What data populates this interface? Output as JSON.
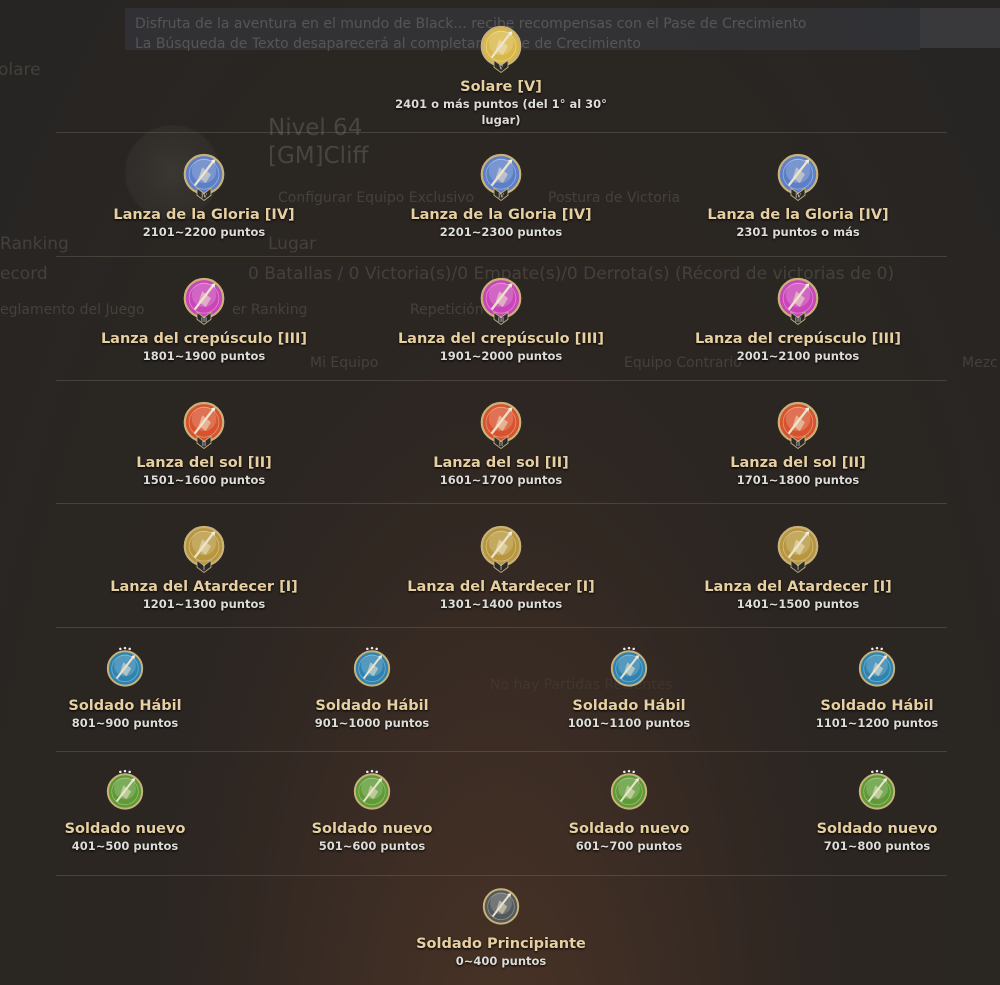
{
  "background": {
    "banner_line1": "Disfruta de la aventura en el mundo de Black... recibe recompensas con el Pase de Crecimiento",
    "banner_line2": "La Búsqueda de Texto desaparecerá al completar... Pase de Crecimiento",
    "side_label": "olare",
    "level": "Nivel 64",
    "player_name": "[GM]Cliff",
    "config_left": "Configurar Equipo Exclusivo",
    "config_right": "Postura de Victoria",
    "lugar": "Lugar",
    "ranking": "Ranking",
    "record": "ecord",
    "record_text": "0 Batallas / 0 Victoria(s)/0 Empate(s)/0 Derrota(s) (Récord de victorias de 0)",
    "reglamento": "eglamento del Juego",
    "ver_ranking": "er Ranking",
    "repeticion": "Repetición",
    "mi_equipo": "Mi Equipo",
    "equipo_contrario": "Equipo Contrario",
    "right_cut": "Mezc",
    "mid_faded": "No hay Partidas Recientes"
  },
  "tiers": [
    {
      "id": "solare",
      "name": "Solare [V]",
      "points": "2401 o más puntos (del 1° al 30° lugar)",
      "tier": "V",
      "color": "#d9b84a"
    },
    {
      "id": "gloria-1",
      "name": "Lanza de la Gloria [IV]",
      "points": "2101~2200 puntos",
      "tier": "IV",
      "color": "#5d7fc6"
    },
    {
      "id": "gloria-2",
      "name": "Lanza de la Gloria [IV]",
      "points": "2201~2300 puntos",
      "tier": "IV",
      "color": "#5d7fc6"
    },
    {
      "id": "gloria-3",
      "name": "Lanza de la Gloria [IV]",
      "points": "2301 puntos o más",
      "tier": "IV",
      "color": "#5d7fc6"
    },
    {
      "id": "crepusculo-1",
      "name": "Lanza del crepúsculo [III]",
      "points": "1801~1900 puntos",
      "tier": "III",
      "color": "#c945b8"
    },
    {
      "id": "crepusculo-2",
      "name": "Lanza del crepúsculo [III]",
      "points": "1901~2000 puntos",
      "tier": "III",
      "color": "#c945b8"
    },
    {
      "id": "crepusculo-3",
      "name": "Lanza del crepúsculo [III]",
      "points": "2001~2100 puntos",
      "tier": "III",
      "color": "#c945b8"
    },
    {
      "id": "sol-1",
      "name": "Lanza del sol [II]",
      "points": "1501~1600 puntos",
      "tier": "II",
      "color": "#d8532d"
    },
    {
      "id": "sol-2",
      "name": "Lanza del sol [II]",
      "points": "1601~1700 puntos",
      "tier": "II",
      "color": "#d8532d"
    },
    {
      "id": "sol-3",
      "name": "Lanza del sol [II]",
      "points": "1701~1800 puntos",
      "tier": "II",
      "color": "#d8532d"
    },
    {
      "id": "atardecer-1",
      "name": "Lanza del Atardecer [I]",
      "points": "1201~1300 puntos",
      "tier": "I",
      "color": "#b8963e"
    },
    {
      "id": "atardecer-2",
      "name": "Lanza del Atardecer [I]",
      "points": "1301~1400 puntos",
      "tier": "I",
      "color": "#b8963e"
    },
    {
      "id": "atardecer-3",
      "name": "Lanza del Atardecer [I]",
      "points": "1401~1500 puntos",
      "tier": "I",
      "color": "#b8963e"
    },
    {
      "id": "habil-1",
      "name": "Soldado Hábil",
      "points": "801~900 puntos",
      "tier": "",
      "color": "#2f83b0"
    },
    {
      "id": "habil-2",
      "name": "Soldado Hábil",
      "points": "901~1000 puntos",
      "tier": "",
      "color": "#2f83b0"
    },
    {
      "id": "habil-3",
      "name": "Soldado Hábil",
      "points": "1001~1100 puntos",
      "tier": "",
      "color": "#2f83b0"
    },
    {
      "id": "habil-4",
      "name": "Soldado Hábil",
      "points": "1101~1200 puntos",
      "tier": "",
      "color": "#2f83b0"
    },
    {
      "id": "nuevo-1",
      "name": "Soldado nuevo",
      "points": "401~500 puntos",
      "tier": "",
      "color": "#5f9a35"
    },
    {
      "id": "nuevo-2",
      "name": "Soldado nuevo",
      "points": "501~600 puntos",
      "tier": "",
      "color": "#5f9a35"
    },
    {
      "id": "nuevo-3",
      "name": "Soldado nuevo",
      "points": "601~700 puntos",
      "tier": "",
      "color": "#5f9a35"
    },
    {
      "id": "nuevo-4",
      "name": "Soldado nuevo",
      "points": "701~800 puntos",
      "tier": "",
      "color": "#5f9a35"
    },
    {
      "id": "principiante",
      "name": "Soldado Principiante",
      "points": "0~400 puntos",
      "tier": "",
      "color": "#55595a"
    }
  ]
}
